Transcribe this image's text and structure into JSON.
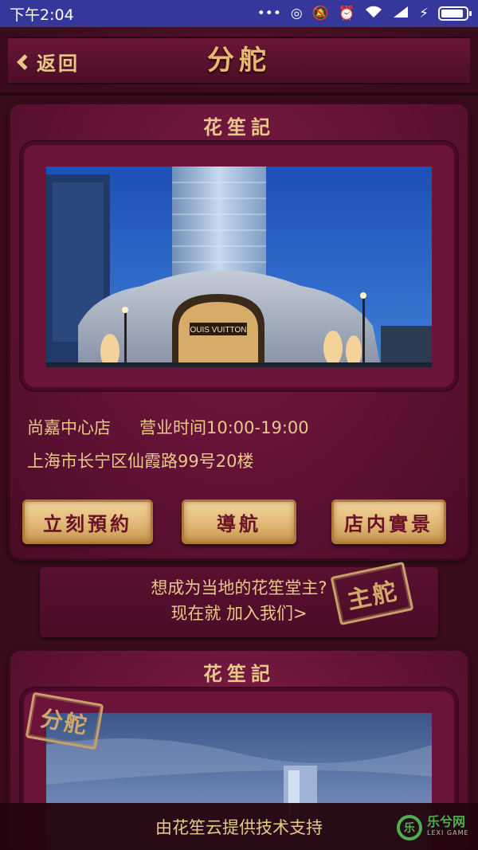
{
  "status_bar": {
    "time": "下午2:04",
    "icons": [
      "more-dots-icon",
      "sync-icon",
      "mute-icon",
      "alarm-icon",
      "wifi-icon",
      "signal-icon",
      "charging-icon",
      "battery-icon"
    ]
  },
  "nav": {
    "back_label": "返回",
    "title": "分舵"
  },
  "cards": [
    {
      "title": "花笙記",
      "store_name": "尚嘉中心店",
      "hours": "营业时间10:00-19:00",
      "address": "上海市长宁区仙霞路99号20楼",
      "photo_sign": "OUIS VUITTON",
      "buttons": {
        "reserve": "立刻預約",
        "navigate": "導航",
        "scene": "店内實景"
      }
    },
    {
      "title": "花笙記"
    }
  ],
  "join": {
    "line1": "想成为当地的花笙堂主?",
    "line2": "现在就 加入我们>",
    "stamp": "主舵"
  },
  "branch_stamp": "分舵",
  "footer": {
    "text": "由花笙云提供技术支持"
  },
  "watermark": {
    "main": "乐兮网",
    "sub": "LEXI GAME"
  },
  "colors": {
    "status_bar": "#35389a",
    "background": "#3a0d1c",
    "card": "#6b1339",
    "gold_text": "#e8c98a",
    "button_text": "#6a1027"
  }
}
